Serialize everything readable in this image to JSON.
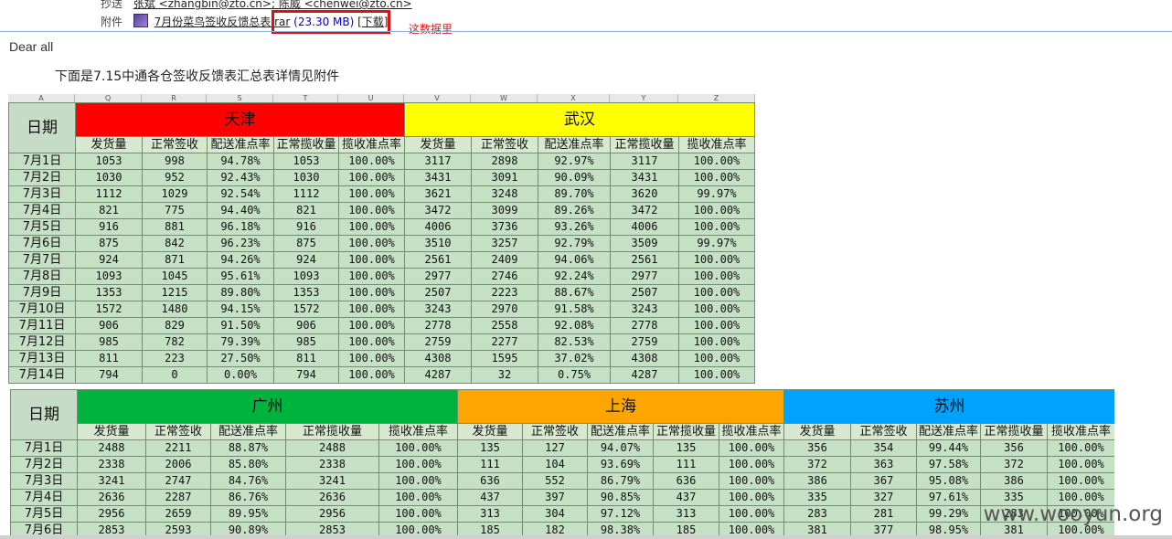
{
  "email": {
    "cc_label": "抄送",
    "cc_value": "张斌 <zhangbin@zto.cn>; 陈威 <chenwei@zto.cn>",
    "attachment_label": "附件",
    "attachment_name": "7月份菜鸟签收反馈总表.rar",
    "attachment_size": "(23.30 MB)",
    "download_label": "[下载]",
    "annotation": "这数据里",
    "greeting": "Dear  all",
    "body": "下面是7.15中通各仓签收反馈表汇总表详情见附件"
  },
  "sheet1": {
    "col_letters": [
      "A",
      "Q",
      "R",
      "S",
      "T",
      "U",
      "V",
      "W",
      "X",
      "Y",
      "Z"
    ],
    "date_header": "日期",
    "cities": [
      {
        "name": "天津",
        "color": "#ff0000"
      },
      {
        "name": "武汉",
        "color": "#ffff00"
      }
    ],
    "sub_headers": [
      "发货量",
      "正常签收",
      "配送准点率",
      "正常揽收量",
      "揽收准点率",
      "发货量",
      "正常签收",
      "配送准点率",
      "正常揽收量",
      "揽收准点率"
    ],
    "rows": [
      [
        "7月1日",
        "1053",
        "998",
        "94.78%",
        "1053",
        "100.00%",
        "3117",
        "2898",
        "92.97%",
        "3117",
        "100.00%"
      ],
      [
        "7月2日",
        "1030",
        "952",
        "92.43%",
        "1030",
        "100.00%",
        "3431",
        "3091",
        "90.09%",
        "3431",
        "100.00%"
      ],
      [
        "7月3日",
        "1112",
        "1029",
        "92.54%",
        "1112",
        "100.00%",
        "3621",
        "3248",
        "89.70%",
        "3620",
        "99.97%"
      ],
      [
        "7月4日",
        "821",
        "775",
        "94.40%",
        "821",
        "100.00%",
        "3472",
        "3099",
        "89.26%",
        "3472",
        "100.00%"
      ],
      [
        "7月5日",
        "916",
        "881",
        "96.18%",
        "916",
        "100.00%",
        "4006",
        "3736",
        "93.26%",
        "4006",
        "100.00%"
      ],
      [
        "7月6日",
        "875",
        "842",
        "96.23%",
        "875",
        "100.00%",
        "3510",
        "3257",
        "92.79%",
        "3509",
        "99.97%"
      ],
      [
        "7月7日",
        "924",
        "871",
        "94.26%",
        "924",
        "100.00%",
        "2561",
        "2409",
        "94.06%",
        "2561",
        "100.00%"
      ],
      [
        "7月8日",
        "1093",
        "1045",
        "95.61%",
        "1093",
        "100.00%",
        "2977",
        "2746",
        "92.24%",
        "2977",
        "100.00%"
      ],
      [
        "7月9日",
        "1353",
        "1215",
        "89.80%",
        "1353",
        "100.00%",
        "2507",
        "2223",
        "88.67%",
        "2507",
        "100.00%"
      ],
      [
        "7月10日",
        "1572",
        "1480",
        "94.15%",
        "1572",
        "100.00%",
        "3243",
        "2970",
        "91.58%",
        "3243",
        "100.00%"
      ],
      [
        "7月11日",
        "906",
        "829",
        "91.50%",
        "906",
        "100.00%",
        "2778",
        "2558",
        "92.08%",
        "2778",
        "100.00%"
      ],
      [
        "7月12日",
        "985",
        "782",
        "79.39%",
        "985",
        "100.00%",
        "2759",
        "2277",
        "82.53%",
        "2759",
        "100.00%"
      ],
      [
        "7月13日",
        "811",
        "223",
        "27.50%",
        "811",
        "100.00%",
        "4308",
        "1595",
        "37.02%",
        "4308",
        "100.00%"
      ],
      [
        "7月14日",
        "794",
        "0",
        "0.00%",
        "794",
        "100.00%",
        "4287",
        "32",
        "0.75%",
        "4287",
        "100.00%"
      ]
    ]
  },
  "sheet2": {
    "date_header": "日期",
    "cities": [
      {
        "name": "广州",
        "color": "#00b33c"
      },
      {
        "name": "上海",
        "color": "#ffa500"
      },
      {
        "name": "苏州",
        "color": "#00a2ff"
      }
    ],
    "sub_headers": [
      "发货量",
      "正常签收",
      "配送准点率",
      "正常揽收量",
      "揽收准点率",
      "发货量",
      "正常签收",
      "配送准点率",
      "正常揽收量",
      "揽收准点率",
      "发货量",
      "正常签收",
      "配送准点率",
      "正常揽收量",
      "揽收准点率"
    ],
    "rows": [
      [
        "7月1日",
        "2488",
        "2211",
        "88.87%",
        "2488",
        "100.00%",
        "135",
        "127",
        "94.07%",
        "135",
        "100.00%",
        "356",
        "354",
        "99.44%",
        "356",
        "100.00%"
      ],
      [
        "7月2日",
        "2338",
        "2006",
        "85.80%",
        "2338",
        "100.00%",
        "111",
        "104",
        "93.69%",
        "111",
        "100.00%",
        "372",
        "363",
        "97.58%",
        "372",
        "100.00%"
      ],
      [
        "7月3日",
        "3241",
        "2747",
        "84.76%",
        "3241",
        "100.00%",
        "636",
        "552",
        "86.79%",
        "636",
        "100.00%",
        "386",
        "367",
        "95.08%",
        "386",
        "100.00%"
      ],
      [
        "7月4日",
        "2636",
        "2287",
        "86.76%",
        "2636",
        "100.00%",
        "437",
        "397",
        "90.85%",
        "437",
        "100.00%",
        "335",
        "327",
        "97.61%",
        "335",
        "100.00%"
      ],
      [
        "7月5日",
        "2956",
        "2659",
        "89.95%",
        "2956",
        "100.00%",
        "313",
        "304",
        "97.12%",
        "313",
        "100.00%",
        "283",
        "281",
        "99.29%",
        "283",
        "100.00%"
      ],
      [
        "7月6日",
        "2853",
        "2593",
        "90.89%",
        "2853",
        "100.00%",
        "185",
        "182",
        "98.38%",
        "185",
        "100.00%",
        "381",
        "377",
        "98.95%",
        "381",
        "100.00%"
      ]
    ]
  },
  "watermark": "www.wooyun.org"
}
